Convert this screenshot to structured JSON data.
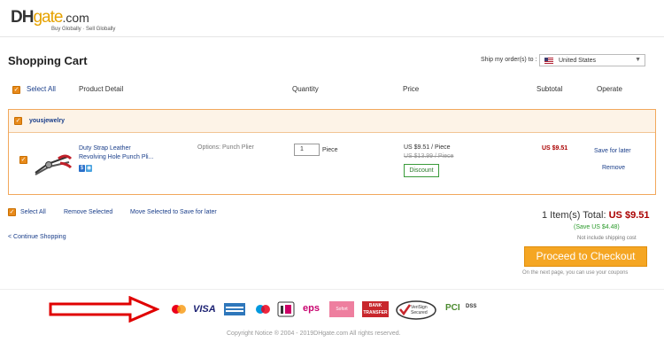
{
  "header": {
    "logo_dh": "DH",
    "logo_gate": "gate",
    "logo_com": ".com",
    "tagline": "Buy Globally · Sell Globally"
  },
  "page_title": "Shopping Cart",
  "ship": {
    "label": "Ship my order(s) to :",
    "country": "United States"
  },
  "columns": {
    "select_all": "Select All",
    "product_detail": "Product Detail",
    "quantity": "Quantity",
    "price": "Price",
    "subtotal": "Subtotal",
    "operate": "Operate"
  },
  "store": {
    "name": "yousjewelry"
  },
  "item": {
    "name_line1": "Duty Strap Leather",
    "name_line2": "Revolving Hole Punch Pli...",
    "options": "Options:  Punch Plier",
    "quantity": "1",
    "unit": "Piece",
    "price": "US $9.51 / Piece",
    "old_price": "US $13.99 / Piece",
    "discount_label": "Discount",
    "subtotal": "US $9.51",
    "save_later": "Save for later",
    "remove": "Remove"
  },
  "bottom_actions": {
    "select_all": "Select All",
    "remove_selected": "Remove Selected",
    "move_selected": "Move Selected to Save for later",
    "continue": "< Continue Shopping"
  },
  "summary": {
    "total_label": "1 Item(s) Total: ",
    "total_amount": "US $9.51",
    "savings": "(Save US $4.48)",
    "shipping_note": "Not include shipping cost",
    "checkout_label": "Proceed to Checkout",
    "checkout_note": "On the next page, you can use your coupons"
  },
  "payment_icons": {
    "visa": "VISA",
    "eps": "eps",
    "sofort": "Sofort",
    "bank_transfer_1": "BANK",
    "bank_transfer_2": "TRANSFER",
    "verisign_1": "VeriSign",
    "verisign_2": "Secured",
    "pci": "PCI",
    "dss": "DSS"
  },
  "footer": {
    "copyright": "Copyright Notice ® 2004 - 2019DHgate.com All rights reserved."
  },
  "colors": {
    "accent_orange": "#f5a623",
    "checkbox_orange": "#e88a1a",
    "link_blue": "#1a3e8a",
    "price_red": "#aa0000",
    "save_green": "#2a9a2a",
    "arrow_red": "#e00000"
  }
}
